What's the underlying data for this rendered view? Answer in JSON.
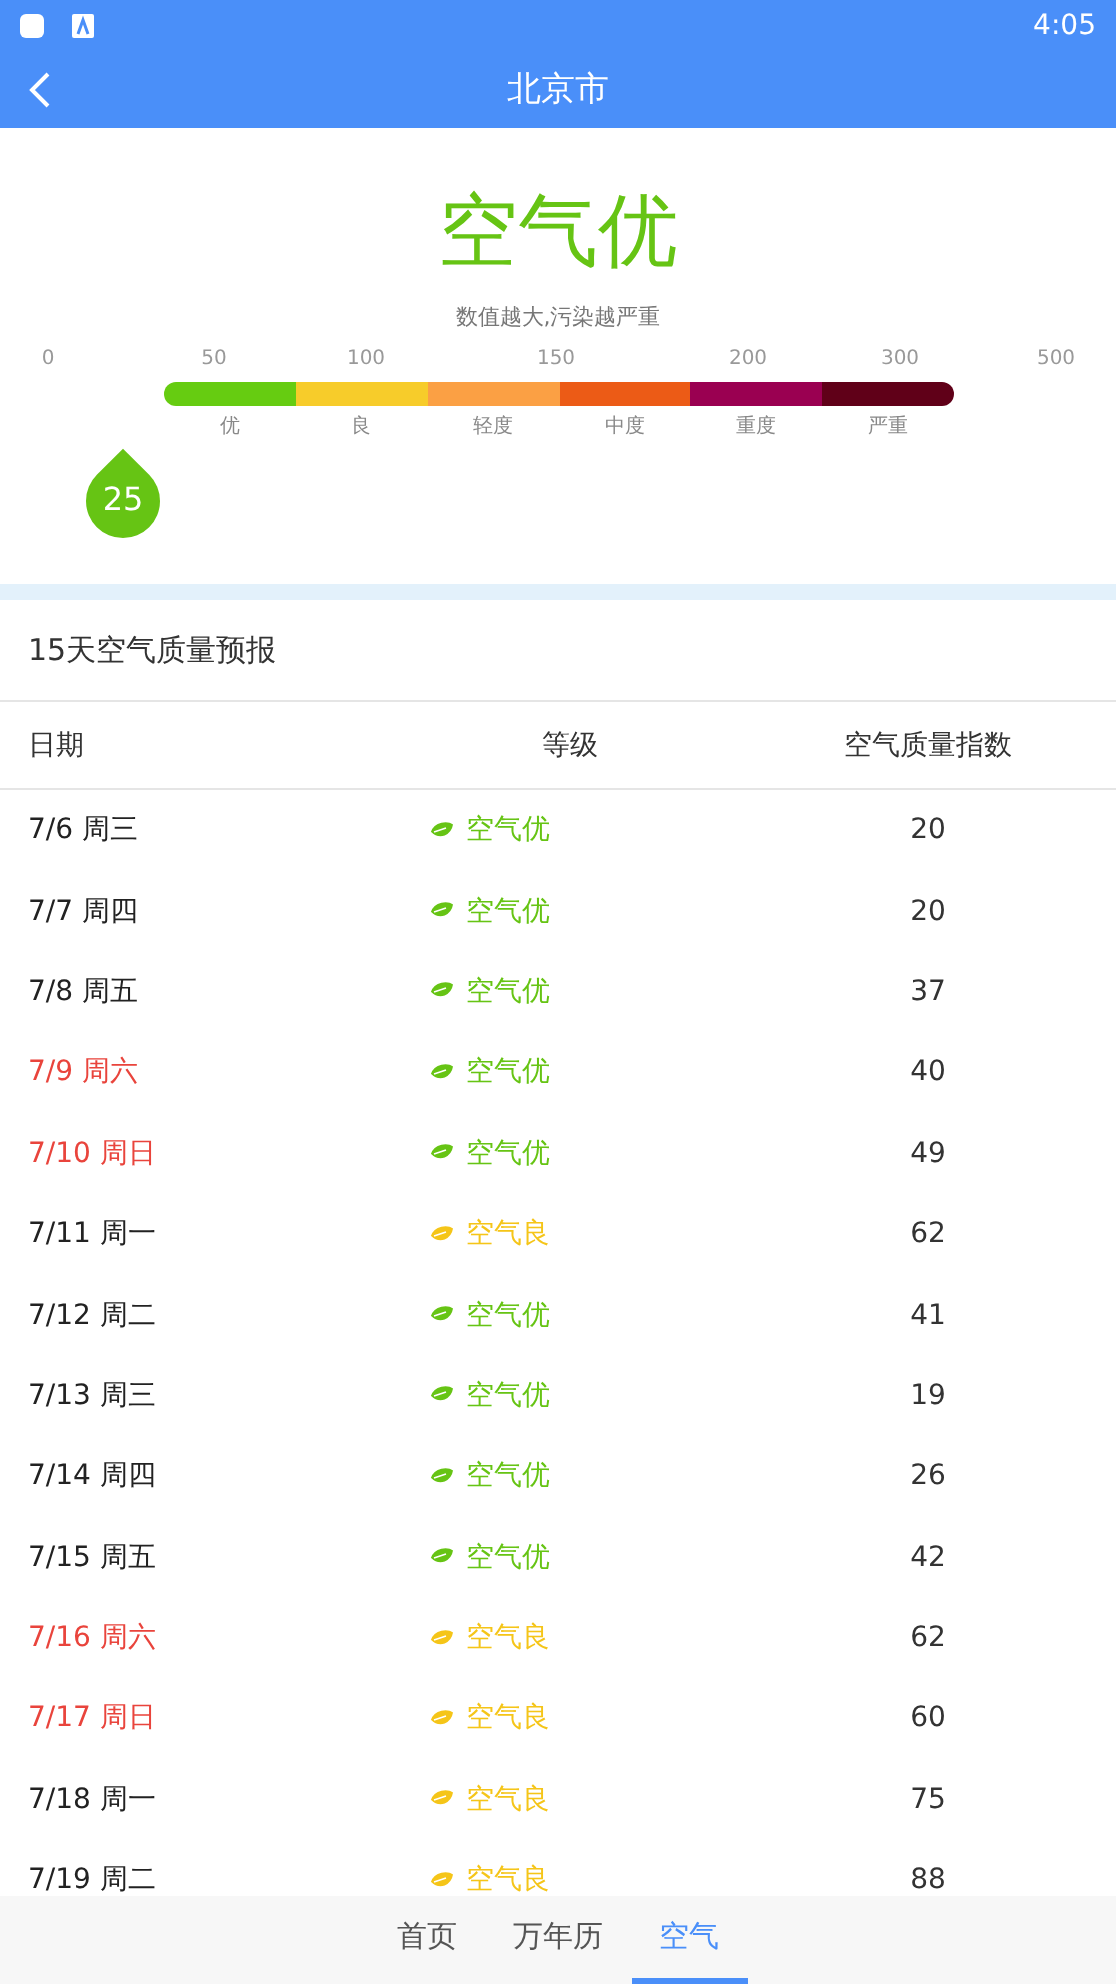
{
  "status_bar": {
    "time": "4:05"
  },
  "header": {
    "title": "北京市"
  },
  "summary": {
    "title": "空气优",
    "hint": "数值越大,污染越严重",
    "value": "25"
  },
  "scale": {
    "ticks": [
      "0",
      "50",
      "100",
      "150",
      "200",
      "300",
      "500"
    ],
    "bands": [
      {
        "label": "优",
        "color": "#66cc11"
      },
      {
        "label": "良",
        "color": "#f7cc2a"
      },
      {
        "label": "轻度",
        "color": "#fba044"
      },
      {
        "label": "中度",
        "color": "#ec5b16"
      },
      {
        "label": "重度",
        "color": "#9a0051"
      },
      {
        "label": "严重",
        "color": "#600018"
      }
    ]
  },
  "forecast": {
    "title": "15天空气质量预报",
    "columns": [
      "日期",
      "等级",
      "空气质量指数"
    ],
    "rows": [
      {
        "date": "7/6 周三",
        "weekend": false,
        "grade": "空气优",
        "color": "#66c414",
        "aqi": "20"
      },
      {
        "date": "7/7 周四",
        "weekend": false,
        "grade": "空气优",
        "color": "#66c414",
        "aqi": "20"
      },
      {
        "date": "7/8 周五",
        "weekend": false,
        "grade": "空气优",
        "color": "#66c414",
        "aqi": "37"
      },
      {
        "date": "7/9 周六",
        "weekend": true,
        "grade": "空气优",
        "color": "#66c414",
        "aqi": "40"
      },
      {
        "date": "7/10 周日",
        "weekend": true,
        "grade": "空气优",
        "color": "#66c414",
        "aqi": "49"
      },
      {
        "date": "7/11 周一",
        "weekend": false,
        "grade": "空气良",
        "color": "#f5c518",
        "aqi": "62"
      },
      {
        "date": "7/12 周二",
        "weekend": false,
        "grade": "空气优",
        "color": "#66c414",
        "aqi": "41"
      },
      {
        "date": "7/13 周三",
        "weekend": false,
        "grade": "空气优",
        "color": "#66c414",
        "aqi": "19"
      },
      {
        "date": "7/14 周四",
        "weekend": false,
        "grade": "空气优",
        "color": "#66c414",
        "aqi": "26"
      },
      {
        "date": "7/15 周五",
        "weekend": false,
        "grade": "空气优",
        "color": "#66c414",
        "aqi": "42"
      },
      {
        "date": "7/16 周六",
        "weekend": true,
        "grade": "空气良",
        "color": "#f5c518",
        "aqi": "62"
      },
      {
        "date": "7/17 周日",
        "weekend": true,
        "grade": "空气良",
        "color": "#f5c518",
        "aqi": "60"
      },
      {
        "date": "7/18 周一",
        "weekend": false,
        "grade": "空气良",
        "color": "#f5c518",
        "aqi": "75"
      },
      {
        "date": "7/19 周二",
        "weekend": false,
        "grade": "空气良",
        "color": "#f5c518",
        "aqi": "88"
      }
    ]
  },
  "nav": [
    {
      "label": "首页",
      "selected": false
    },
    {
      "label": "万年历",
      "selected": false
    },
    {
      "label": "空气",
      "selected": true
    }
  ]
}
